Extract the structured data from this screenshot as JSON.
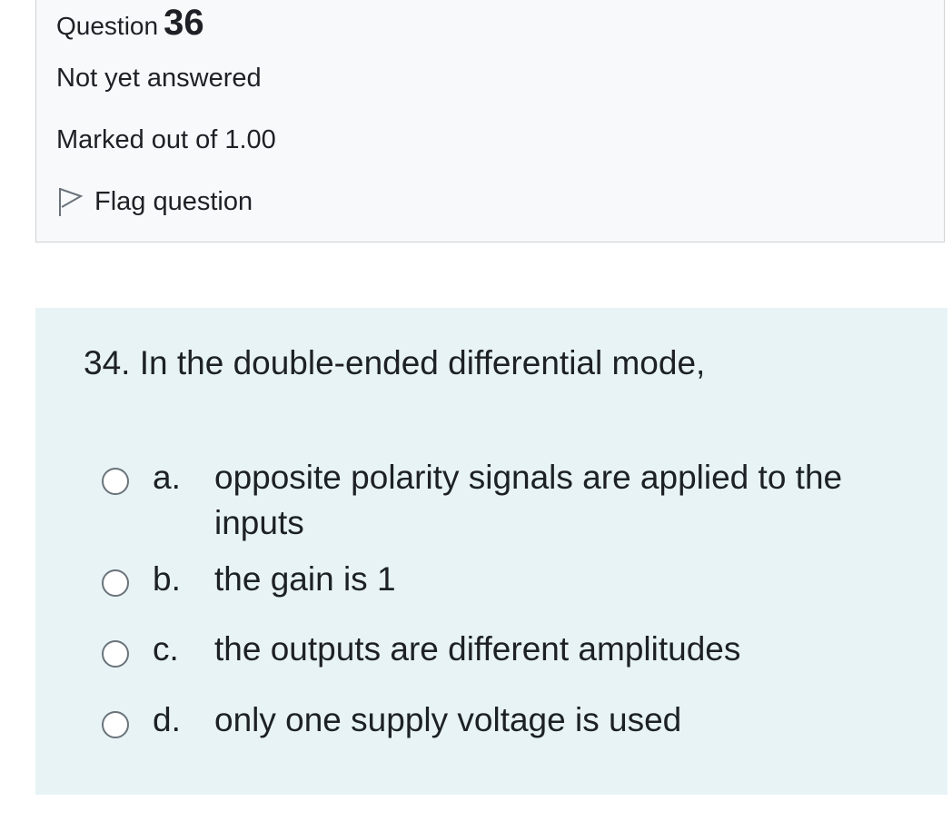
{
  "info": {
    "question_label": "Question",
    "question_number": "36",
    "state": "Not yet answered",
    "grade": "Marked out of 1.00",
    "flag_label": "Flag question"
  },
  "formulation": {
    "question_text": "34. In the double-ended differential mode,",
    "answers": [
      {
        "letter": "a.",
        "text": "opposite polarity signals are applied to the inputs"
      },
      {
        "letter": "b.",
        "text": "the gain is 1"
      },
      {
        "letter": "c.",
        "text": "the outputs are different amplitudes"
      },
      {
        "letter": "d.",
        "text": "only one supply voltage is used"
      }
    ]
  }
}
